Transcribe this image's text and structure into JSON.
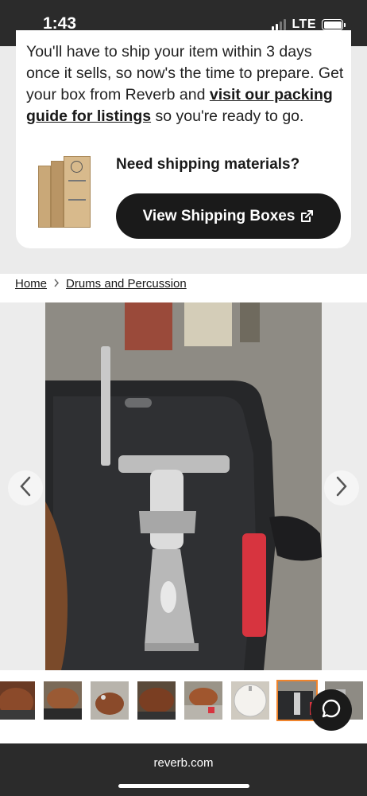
{
  "status_bar": {
    "time": "1:43",
    "network": "LTE",
    "icons": [
      "signal-icon",
      "battery-icon"
    ]
  },
  "shipping": {
    "text_before_link": "You'll have to ship your item within 3 days once it sells, so now's the time to prepare. Get your box from Reverb and ",
    "link_text": "visit our packing guide for listings",
    "text_after_link": " so you're ready to go.",
    "materials_title": "Need shipping materials?",
    "button_label": "View Shipping Boxes",
    "button_icon": "external-link-icon"
  },
  "breadcrumb": {
    "items": [
      "Home",
      "Drums and Percussion"
    ],
    "separator_icon": "chevron-right-icon"
  },
  "gallery": {
    "nav_icons": [
      "chevron-left-icon",
      "chevron-right-icon"
    ],
    "thumbnail_count": 8,
    "active_thumbnail_index": 6
  },
  "chat": {
    "icon": "chat-bubble-icon"
  },
  "browser": {
    "url": "reverb.com"
  },
  "colors": {
    "dark": "#1a1a1a",
    "status_bg": "#2b2b2b",
    "active_thumb_border": "#f0842c",
    "page_bg": "#ebebeb"
  }
}
